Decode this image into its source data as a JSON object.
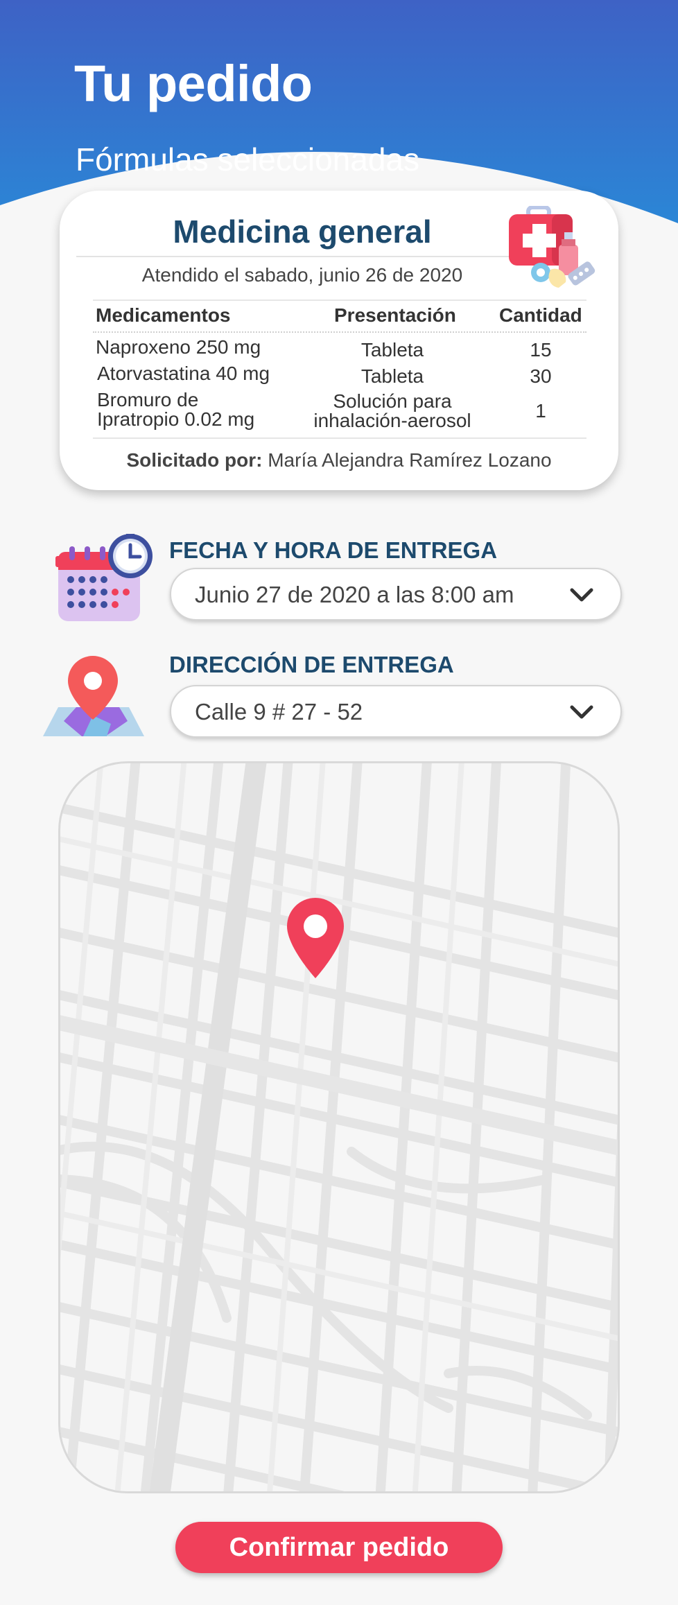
{
  "header": {
    "title": "Tu pedido",
    "subtitle": "Fórmulas seleccionadas"
  },
  "order_card": {
    "title": "Medicina general",
    "date": "Atendido el sabado, junio 26 de 2020",
    "icon": "first-aid-kit-icon",
    "columns": [
      "Medicamentos",
      "Presentación",
      "Cantidad"
    ],
    "rows": [
      {
        "medicine": "Naproxeno 250 mg",
        "presentation": "Tableta",
        "quantity": "15"
      },
      {
        "medicine": "Atorvastatina 40 mg",
        "presentation": "Tableta",
        "quantity": "30"
      },
      {
        "medicine_line1": "Bromuro de",
        "medicine_line2": "Ipratropio 0.02 mg",
        "presentation_line1": "Solución para",
        "presentation_line2": "inhalación-aerosol",
        "quantity": "1"
      }
    ],
    "requested_label": "Solicitado por:",
    "requested_name": " María Alejandra Ramírez Lozano"
  },
  "delivery_time": {
    "label": "FECHA Y HORA DE ENTREGA",
    "value": "Junio 27 de 2020 a las 8:00 am",
    "icon": "calendar-clock-icon"
  },
  "delivery_address": {
    "label": "DIRECCIÓN DE ENTREGA",
    "value": "Calle 9 # 27 - 52",
    "icon": "location-pin-map-icon"
  },
  "confirm_button": "Confirmar pedido",
  "colors": {
    "header_blue_top": "#3b63c6",
    "header_blue_bottom": "#2d85d6",
    "heading_navy": "#1d4a6d",
    "accent_red": "#f0405a"
  }
}
